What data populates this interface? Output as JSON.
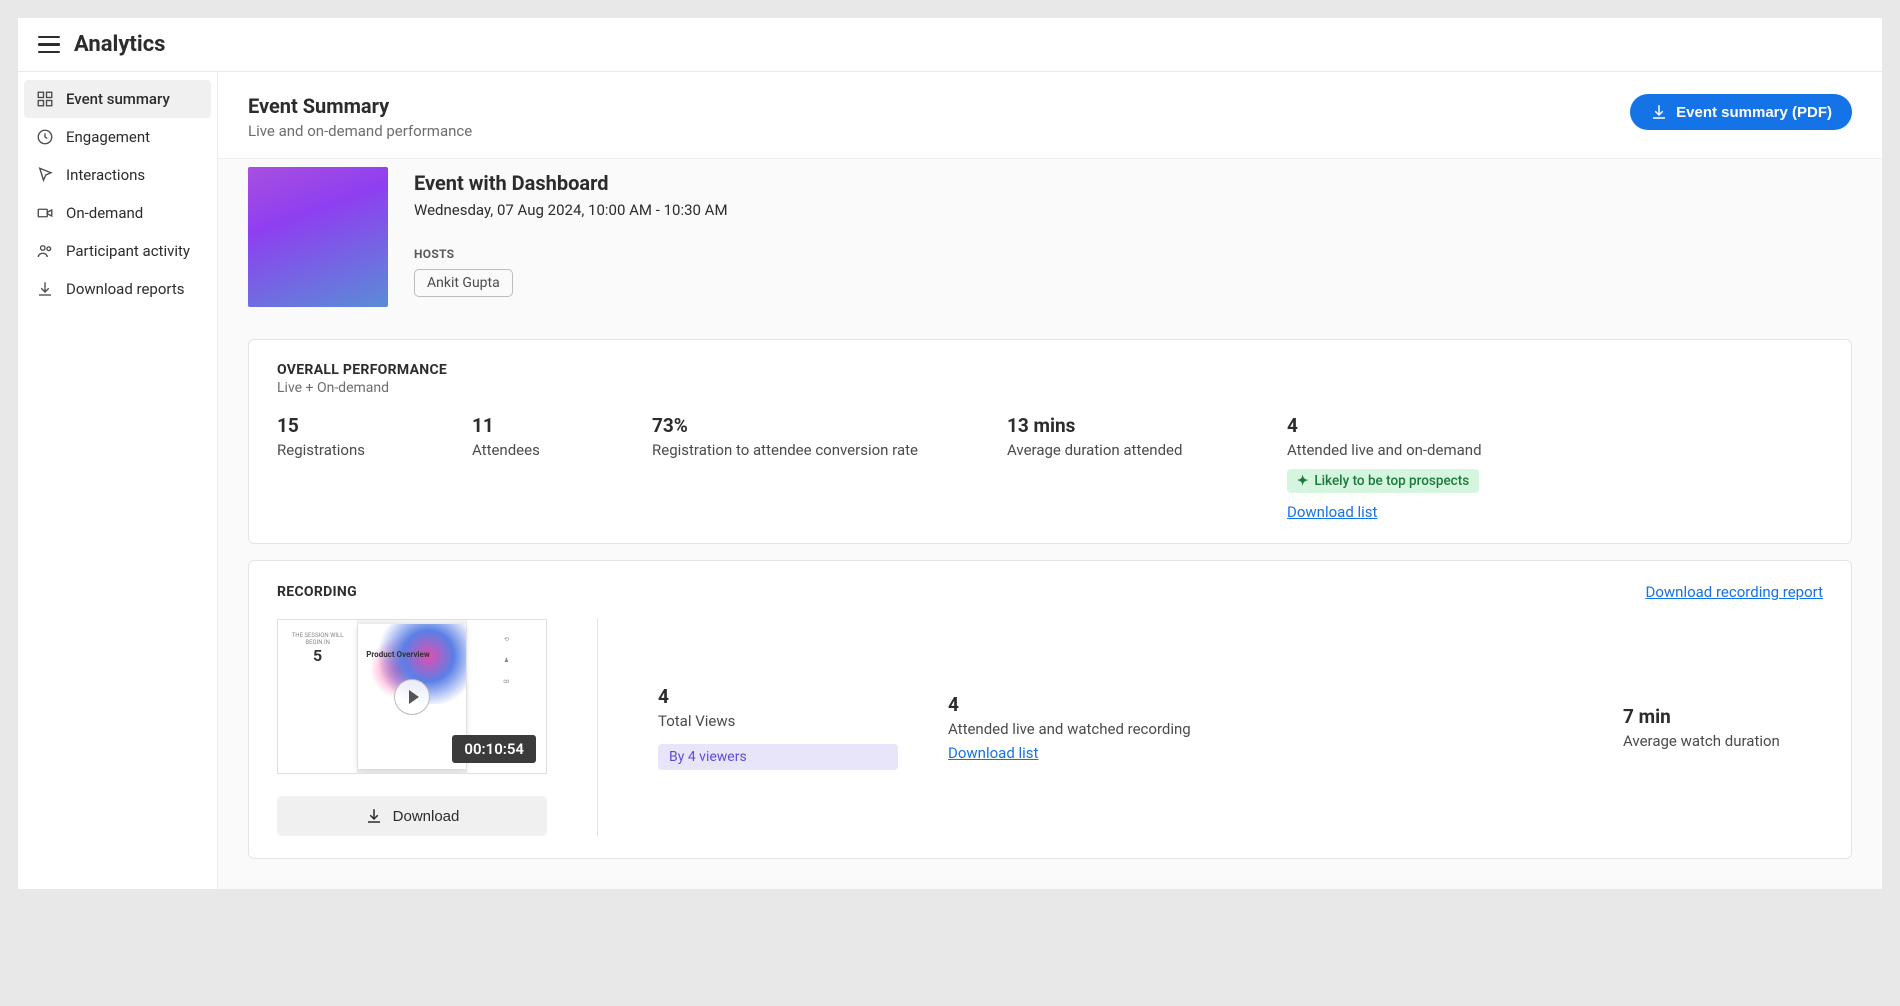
{
  "app": {
    "title": "Analytics"
  },
  "sidebar": {
    "items": [
      {
        "label": "Event summary",
        "active": true
      },
      {
        "label": "Engagement"
      },
      {
        "label": "Interactions"
      },
      {
        "label": "On-demand"
      },
      {
        "label": "Participant activity"
      },
      {
        "label": "Download reports"
      }
    ]
  },
  "page": {
    "title": "Event Summary",
    "subtitle": "Live and on-demand performance",
    "pdf_button": "Event summary (PDF)"
  },
  "event": {
    "title": "Event with Dashboard",
    "datetime": "Wednesday, 07 Aug 2024, 10:00 AM - 10:30 AM",
    "hosts_label": "HOSTS",
    "hosts": [
      "Ankit Gupta"
    ]
  },
  "overall": {
    "title": "OVERALL PERFORMANCE",
    "subtitle": "Live + On-demand",
    "metrics": [
      {
        "value": "15",
        "label": "Registrations"
      },
      {
        "value": "11",
        "label": "Attendees"
      },
      {
        "value": "73%",
        "label": "Registration to attendee conversion rate"
      },
      {
        "value": "13 mins",
        "label": "Average duration attended"
      },
      {
        "value": "4",
        "label": "Attended live and on-demand"
      }
    ],
    "prospect_badge": "Likely to be top prospects",
    "download_list": "Download list"
  },
  "recording": {
    "title": "RECORDING",
    "download_report": "Download recording report",
    "duration": "00:10:54",
    "thumb_title": "Product Overview",
    "download_button": "Download",
    "metrics": [
      {
        "value": "4",
        "label": "Total Views",
        "chip": "By 4 viewers"
      },
      {
        "value": "4",
        "label": "Attended live and watched recording",
        "link": "Download list"
      },
      {
        "value": "7 min",
        "label": "Average watch duration"
      }
    ]
  }
}
